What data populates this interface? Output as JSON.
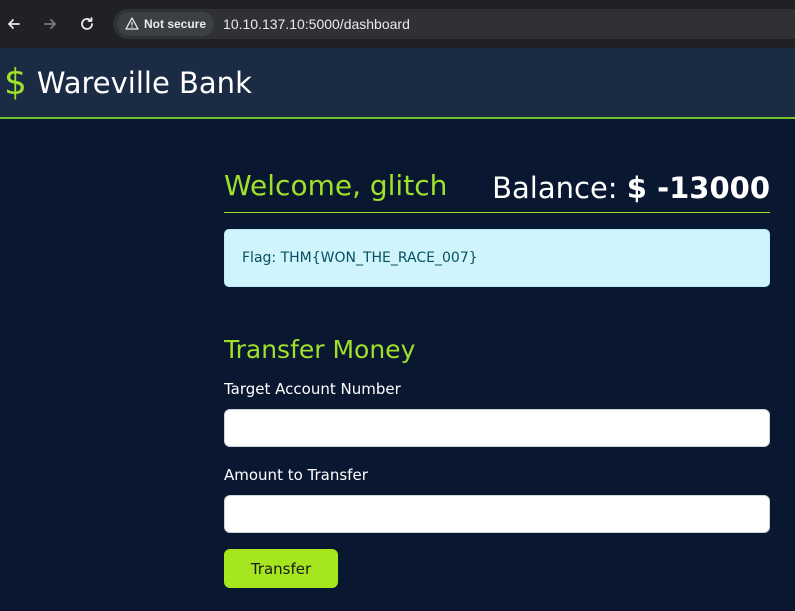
{
  "browser": {
    "security_label": "Not secure",
    "url": "10.10.137.10:5000/dashboard"
  },
  "header": {
    "logo_icon": "$",
    "title": "Wareville Bank"
  },
  "dashboard": {
    "welcome": "Welcome, glitch",
    "balance_label": "Balance:",
    "balance_amount": "$ -13000",
    "flag_message": "Flag: THM{WON_THE_RACE_007}"
  },
  "transfer": {
    "section_title": "Transfer Money",
    "account_label": "Target Account Number",
    "account_value": "",
    "amount_label": "Amount to Transfer",
    "amount_value": "",
    "button_label": "Transfer"
  },
  "colors": {
    "accent": "#9fe02a",
    "background": "#0a1730",
    "header_bg": "#1b2b44",
    "alert_bg": "#cff4fc"
  }
}
